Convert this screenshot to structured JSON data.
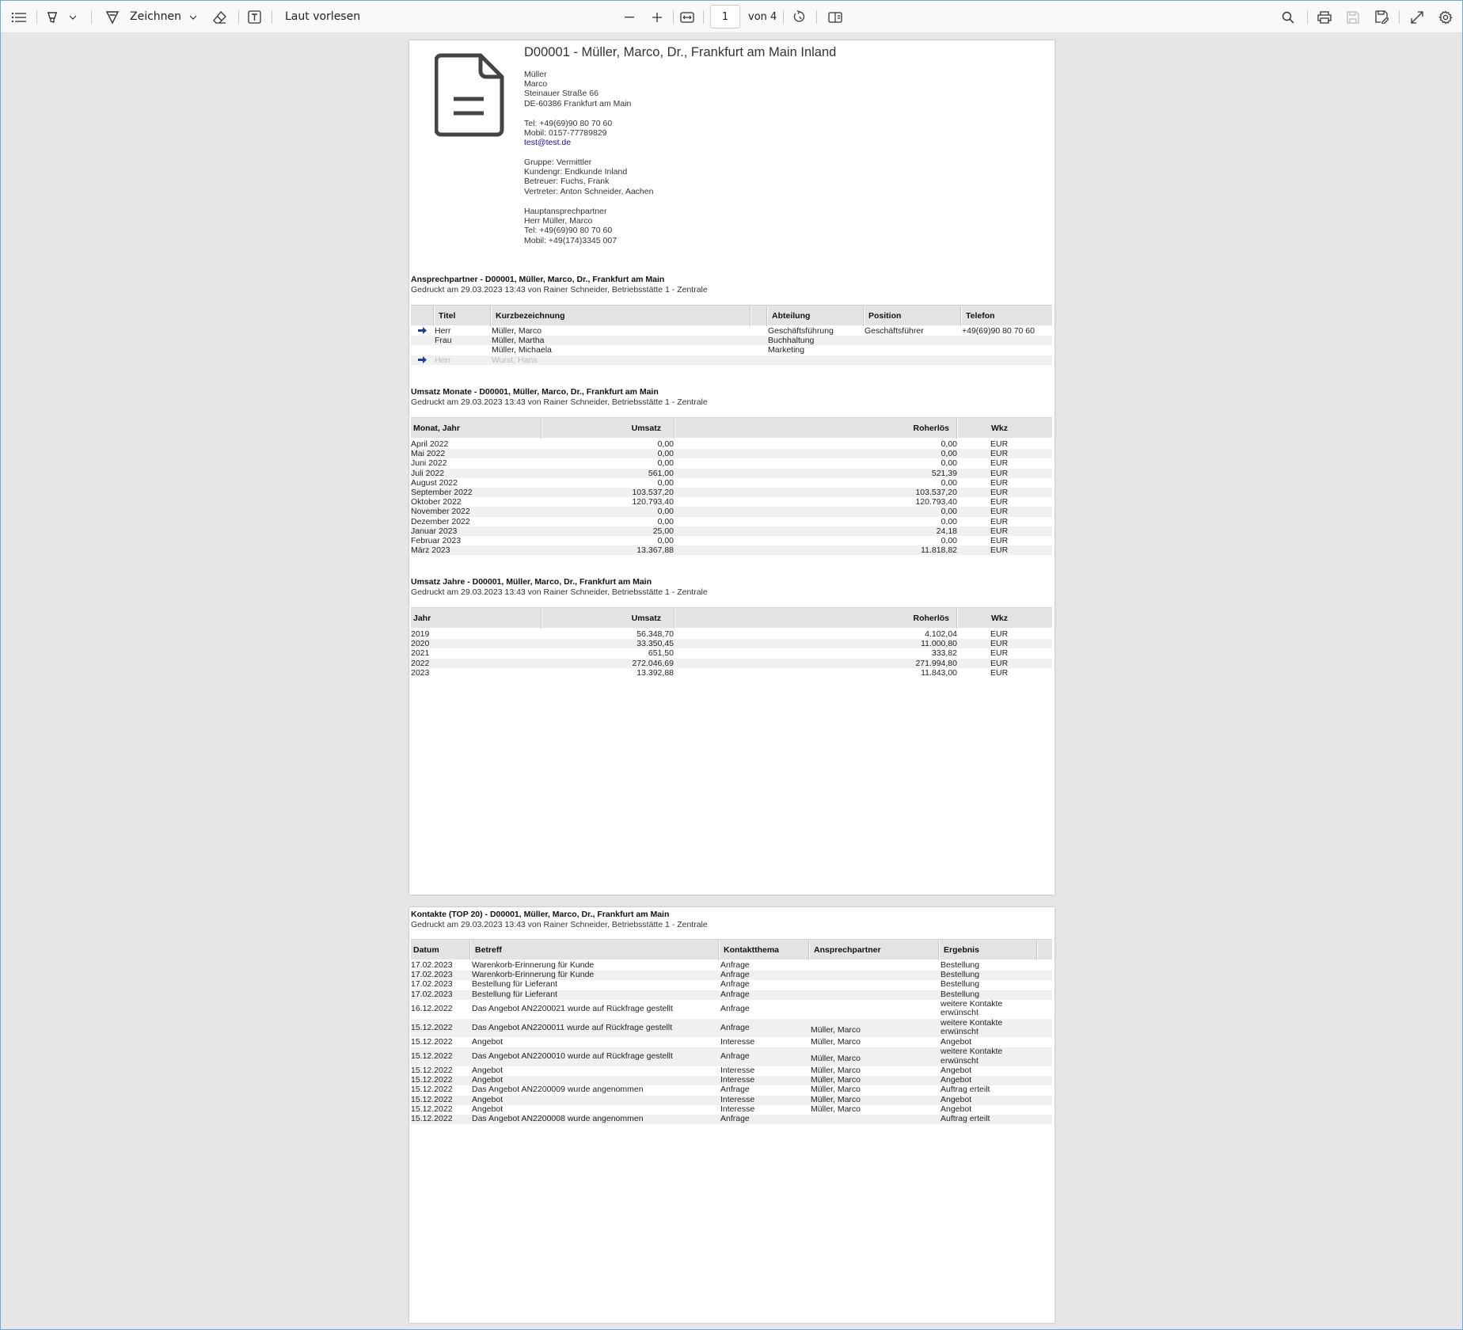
{
  "toolbar": {
    "draw_label": "Zeichnen",
    "read_aloud_label": "Laut vorlesen",
    "page_current": "1",
    "page_total_label": "von 4"
  },
  "customer": {
    "title": "D00001 - Müller, Marco, Dr., Frankfurt am Main Inland",
    "address_lines": [
      "Müller",
      "Marco",
      "Steinauer Straße 66",
      "DE-60386 Frankfurt am Main"
    ],
    "phone": "Tel: +49(69)90 80 70 60",
    "mobile": "Mobil: 0157-77789829",
    "email": "test@test.de",
    "info_lines": [
      "Gruppe: Vermittler",
      "Kundengr: Endkunde Inland",
      "Betreuer: Fuchs, Frank",
      "Vertreter: Anton Schneider, Aachen"
    ],
    "contact_lines": [
      "Hauptansprechpartner",
      "Herr Müller, Marco",
      "Tel: +49(69)90 80 70 60",
      "Mobil: +49(174)3345 007"
    ]
  },
  "contacts": {
    "title": "Ansprechpartner - D00001, Müller, Marco, Dr., Frankfurt am Main",
    "printed": "Gedruckt am 29.03.2023 13:43 von Rainer Schneider, Betriebsstätte 1 - Zentrale",
    "headers": [
      "Titel",
      "Kurzbezeichnung",
      "Abteilung",
      "Position",
      "Telefon"
    ],
    "rows": [
      {
        "main": true,
        "inactive": false,
        "titel": "Herr",
        "name": "Müller, Marco",
        "abteilung": "Geschäftsführung",
        "position": "Geschäftsführer",
        "telefon": "+49(69)90 80 70 60"
      },
      {
        "main": false,
        "inactive": false,
        "titel": "Frau",
        "name": "Müller, Martha",
        "abteilung": "Buchhaltung",
        "position": "",
        "telefon": ""
      },
      {
        "main": false,
        "inactive": false,
        "titel": "",
        "name": "Müller, Michaela",
        "abteilung": "Marketing",
        "position": "",
        "telefon": ""
      },
      {
        "main": true,
        "inactive": true,
        "titel": "Herr",
        "name": "Wurst, Hans",
        "abteilung": "",
        "position": "",
        "telefon": ""
      }
    ]
  },
  "monthly": {
    "title": "Umsatz Monate - D00001, Müller, Marco, Dr., Frankfurt am Main",
    "printed": "Gedruckt am 29.03.2023 13:43 von Rainer Schneider, Betriebsstätte 1 - Zentrale",
    "headers": [
      "Monat, Jahr",
      "Umsatz",
      "Roherlös",
      "Wkz"
    ],
    "rows": [
      [
        "April 2022",
        "0,00",
        "0,00",
        "EUR"
      ],
      [
        "Mai 2022",
        "0,00",
        "0,00",
        "EUR"
      ],
      [
        "Juni 2022",
        "0,00",
        "0,00",
        "EUR"
      ],
      [
        "Juli 2022",
        "561,00",
        "521,39",
        "EUR"
      ],
      [
        "August 2022",
        "0,00",
        "0,00",
        "EUR"
      ],
      [
        "September 2022",
        "103.537,20",
        "103.537,20",
        "EUR"
      ],
      [
        "Oktober 2022",
        "120.793,40",
        "120.793,40",
        "EUR"
      ],
      [
        "November 2022",
        "0,00",
        "0,00",
        "EUR"
      ],
      [
        "Dezember 2022",
        "0,00",
        "0,00",
        "EUR"
      ],
      [
        "Januar 2023",
        "25,00",
        "24,18",
        "EUR"
      ],
      [
        "Februar 2023",
        "0,00",
        "0,00",
        "EUR"
      ],
      [
        "März 2023",
        "13.367,88",
        "11.818,82",
        "EUR"
      ]
    ]
  },
  "yearly": {
    "title": "Umsatz Jahre - D00001, Müller, Marco, Dr., Frankfurt am Main",
    "printed": "Gedruckt am 29.03.2023 13:43 von Rainer Schneider, Betriebsstätte 1 - Zentrale",
    "headers": [
      "Jahr",
      "Umsatz",
      "Roherlös",
      "Wkz"
    ],
    "rows": [
      [
        "2019",
        "56.348,70",
        "4.102,04",
        "EUR"
      ],
      [
        "2020",
        "33.350,45",
        "11.000,80",
        "EUR"
      ],
      [
        "2021",
        "651,50",
        "333,82",
        "EUR"
      ],
      [
        "2022",
        "272.046,69",
        "271.994,80",
        "EUR"
      ],
      [
        "2023",
        "13.392,88",
        "11.843,00",
        "EUR"
      ]
    ]
  },
  "kontakte": {
    "title": "Kontakte (TOP 20) - D00001, Müller, Marco, Dr., Frankfurt am Main",
    "printed": "Gedruckt am 29.03.2023 13:43 von Rainer Schneider, Betriebsstätte 1 - Zentrale",
    "headers": [
      "Datum",
      "Betreff",
      "Kontaktthema",
      "Ansprechpartner",
      "Ergebnis"
    ],
    "rows": [
      [
        "17.02.2023",
        "Warenkorb-Erinnerung für Kunde",
        "Anfrage",
        "",
        "Bestellung"
      ],
      [
        "17.02.2023",
        "Warenkorb-Erinnerung für Kunde",
        "Anfrage",
        "",
        "Bestellung"
      ],
      [
        "17.02.2023",
        "Bestellung für Lieferant",
        "Anfrage",
        "",
        "Bestellung"
      ],
      [
        "17.02.2023",
        "Bestellung für Lieferant",
        "Anfrage",
        "",
        "Bestellung"
      ],
      [
        "16.12.2022",
        "Das Angebot AN2200021 wurde auf Rückfrage gestellt",
        "Anfrage",
        "",
        "weitere Kontakte erwünscht"
      ],
      [
        "15.12.2022",
        "Das Angebot AN2200011 wurde auf Rückfrage gestellt",
        "Anfrage",
        "Müller, Marco",
        "weitere Kontakte erwünscht"
      ],
      [
        "15.12.2022",
        "Angebot",
        "Interesse",
        "Müller, Marco",
        "Angebot"
      ],
      [
        "15.12.2022",
        "Das Angebot AN2200010 wurde auf Rückfrage gestellt",
        "Anfrage",
        "Müller, Marco",
        "weitere Kontakte erwünscht"
      ],
      [
        "15.12.2022",
        "Angebot",
        "Interesse",
        "Müller, Marco",
        "Angebot"
      ],
      [
        "15.12.2022",
        "Angebot",
        "Interesse",
        "Müller, Marco",
        "Angebot"
      ],
      [
        "15.12.2022",
        "Das Angebot AN2200009 wurde angenommen",
        "Anfrage",
        "Müller, Marco",
        "Auftrag erteilt"
      ],
      [
        "15.12.2022",
        "Angebot",
        "Interesse",
        "Müller, Marco",
        "Angebot"
      ],
      [
        "15.12.2022",
        "Angebot",
        "Interesse",
        "Müller, Marco",
        "Angebot"
      ],
      [
        "15.12.2022",
        "Das Angebot AN2200008 wurde angenommen",
        "Anfrage",
        "",
        "Auftrag erteilt"
      ]
    ]
  },
  "colors": {
    "link": "#1a0dab",
    "header_bg": "#e3e3e3",
    "alt_row": "#f0f0f0",
    "arrow": "#1f3f8f"
  }
}
